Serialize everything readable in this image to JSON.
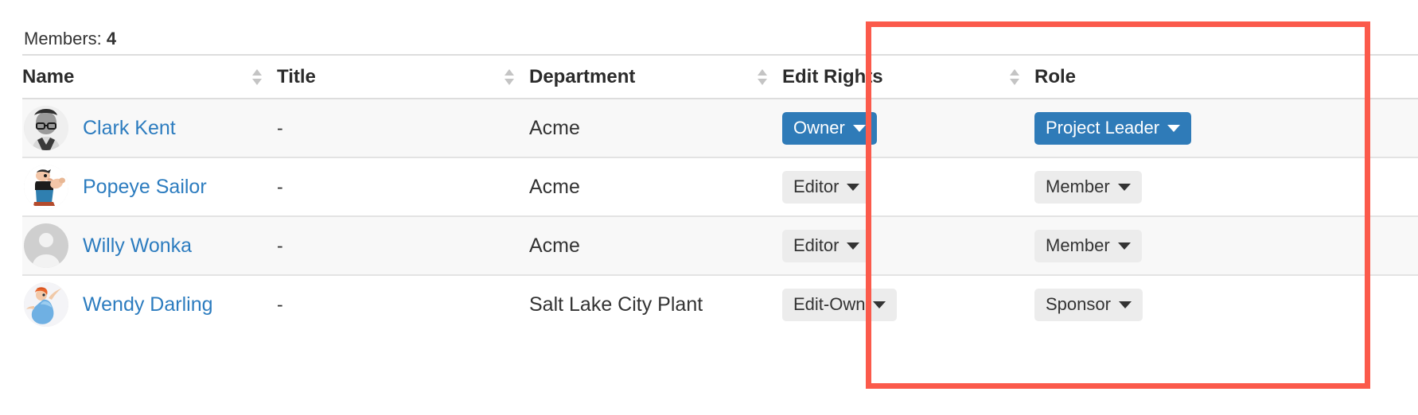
{
  "summary": {
    "label": "Members:",
    "count": "4"
  },
  "table": {
    "columns": [
      {
        "key": "name",
        "label": "Name",
        "sortable": true,
        "sort_icon": "sort-updown-icon"
      },
      {
        "key": "title",
        "label": "Title",
        "sortable": true,
        "sort_icon": "sort-updown-icon"
      },
      {
        "key": "dept",
        "label": "Department",
        "sortable": true,
        "sort_icon": "sort-updown-icon"
      },
      {
        "key": "rights",
        "label": "Edit Rights",
        "sortable": true,
        "sort_icon": "sort-updown-icon"
      },
      {
        "key": "role",
        "label": "Role",
        "sortable": false,
        "sort_icon": ""
      }
    ],
    "rows": [
      {
        "avatar": "avatar-photo-man-glasses",
        "name": "Clark Kent",
        "title": "-",
        "department": "Acme",
        "edit_rights": {
          "label": "Owner",
          "style": "primary",
          "caret": "caret-down-icon"
        },
        "role": {
          "label": "Project Leader",
          "style": "primary",
          "caret": "caret-down-icon"
        }
      },
      {
        "avatar": "avatar-cartoon-popeye",
        "name": "Popeye Sailor",
        "title": "-",
        "department": "Acme",
        "edit_rights": {
          "label": "Editor",
          "style": "muted",
          "caret": "caret-down-icon"
        },
        "role": {
          "label": "Member",
          "style": "muted",
          "caret": "caret-down-icon"
        }
      },
      {
        "avatar": "avatar-default-silhouette",
        "name": "Willy Wonka",
        "title": "-",
        "department": "Acme",
        "edit_rights": {
          "label": "Editor",
          "style": "muted",
          "caret": "caret-down-icon"
        },
        "role": {
          "label": "Member",
          "style": "muted",
          "caret": "caret-down-icon"
        }
      },
      {
        "avatar": "avatar-cartoon-wendy",
        "name": "Wendy Darling",
        "title": "-",
        "department": "Salt Lake City Plant",
        "edit_rights": {
          "label": "Edit-Own",
          "style": "muted",
          "caret": "caret-down-icon"
        },
        "role": {
          "label": "Sponsor",
          "style": "muted",
          "caret": "caret-down-icon"
        }
      }
    ]
  },
  "annotation": {
    "highlight_color": "#fb5a4b",
    "covers_columns": "Edit Rights, Role"
  },
  "colors": {
    "link": "#2c7cbf",
    "primary_button": "#2f7bb8",
    "muted_button": "#ececec",
    "row_alt": "#f8f8f8",
    "border": "#e3e3e3"
  }
}
